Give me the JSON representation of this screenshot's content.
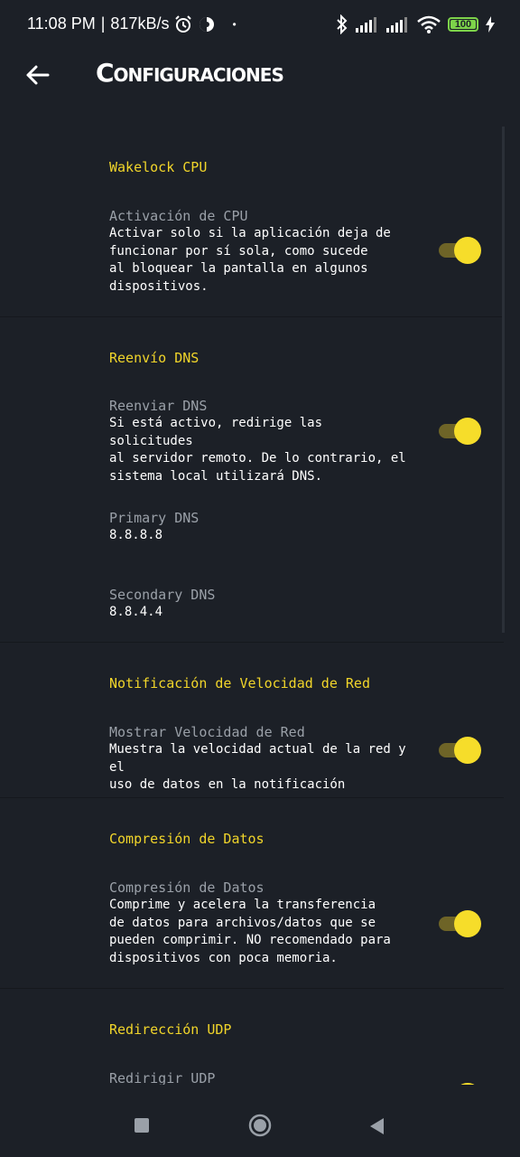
{
  "status_bar": {
    "time": "11:08 PM",
    "separator": "|",
    "speed": "817kB/s",
    "dot": "•",
    "battery": "100",
    "icons": [
      "alarm-icon",
      "vpn-icon",
      "bluetooth-icon",
      "signal-icon",
      "signal-icon",
      "wifi-icon",
      "battery-icon",
      "charging-icon"
    ],
    "battery_color": "#7dd34a"
  },
  "app_bar": {
    "title": "Configuraciones",
    "back_icon": "arrow-left-icon"
  },
  "accent_color": "#f1d52a",
  "sections": [
    {
      "title": "Wakelock CPU",
      "items": [
        {
          "title": "Activación de CPU",
          "desc_lines": [
            "Activar solo si la aplicación deja de",
            "funcionar por sí sola, como sucede",
            "al bloquear la pantalla en algunos",
            "dispositivos."
          ],
          "toggle": true
        }
      ]
    },
    {
      "title": "Reenvío DNS",
      "items": [
        {
          "title": "Reenviar DNS",
          "desc_lines": [
            "Si está activo, redirige las solicitudes",
            "al servidor remoto. De lo contrario, el",
            "sistema local utilizará DNS."
          ],
          "toggle": true
        },
        {
          "title": "Primary DNS",
          "value": "8.8.8.8"
        },
        {
          "title": "Secondary DNS",
          "value": "8.8.4.4"
        }
      ]
    },
    {
      "title": "Notificación de Velocidad de Red",
      "items": [
        {
          "title": "Mostrar Velocidad de Red",
          "desc_lines": [
            "Muestra la velocidad actual de la red y el",
            "uso de datos en la notificación"
          ],
          "toggle": true
        }
      ]
    },
    {
      "title": "Compresión de Datos",
      "items": [
        {
          "title": "Compresión de Datos",
          "desc_lines": [
            "Comprime y acelera la transferencia",
            "de datos para archivos/datos que se",
            "pueden comprimir. NO recomendado para",
            "dispositivos con poca memoria."
          ],
          "toggle": true
        }
      ]
    },
    {
      "title": "Redirección UDP",
      "items": [
        {
          "title": "Redirigir UDP",
          "toggle": true
        }
      ]
    }
  ],
  "nav_bar": {
    "icons": [
      "recents-square-icon",
      "home-circle-icon",
      "back-triangle-icon"
    ]
  }
}
